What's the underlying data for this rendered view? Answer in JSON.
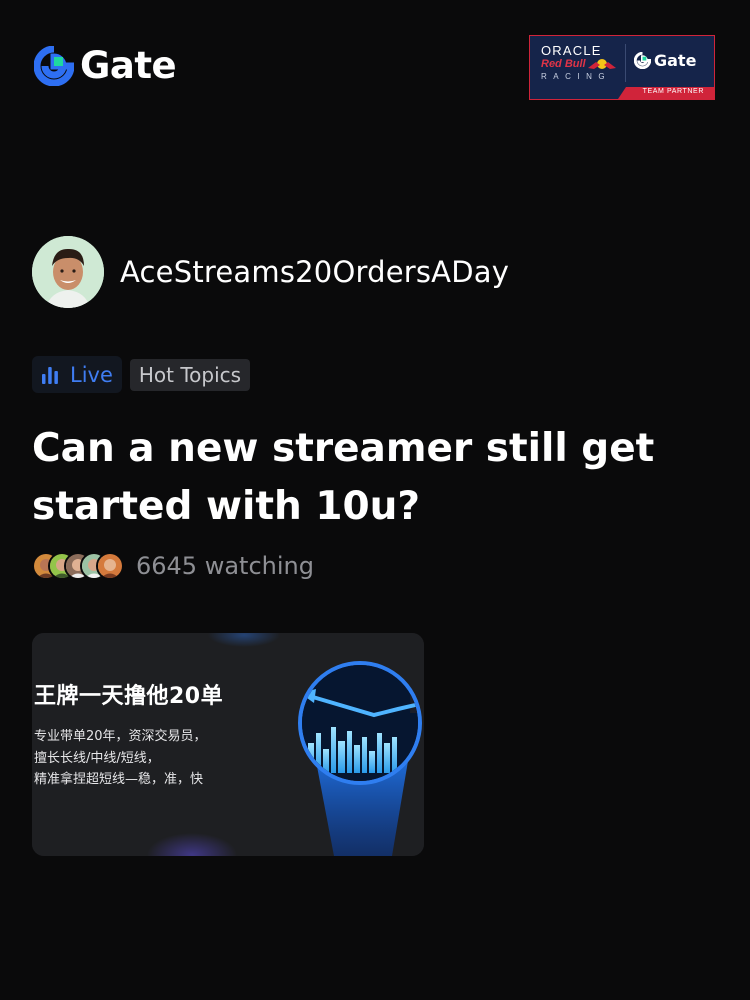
{
  "header": {
    "brand_name": "Gate",
    "partner": {
      "oracle": "ORACLE",
      "redbull": "Red Bull",
      "racing": "RACING",
      "gate_name": "Gate",
      "banner": "TEAM PARTNER",
      "colors": {
        "navy": "#15244a",
        "red": "#d0243a"
      }
    }
  },
  "stream": {
    "username": "AceStreams20OrdersADay",
    "live_label": "Live",
    "topic_label": "Hot Topics",
    "title": "Can a new streamer still get started with 10u?",
    "watching": "6645 watching"
  },
  "thumbnail": {
    "headline": "王牌一天撸他20单",
    "lines": [
      "专业带单20年，资深交易员，",
      "擅长长线/中线/短线，",
      "精准拿捏超短线—稳，准，快"
    ]
  },
  "colors": {
    "background": "#0a0a0b",
    "accent_blue": "#3f7df2",
    "brand_blue": "#2e6ff2",
    "brand_green": "#1fd8a0"
  }
}
